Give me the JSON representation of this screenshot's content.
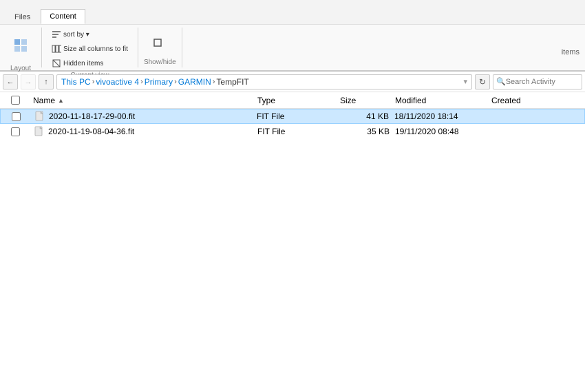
{
  "ribbon": {
    "tabs": [
      {
        "id": "files",
        "label": "Files"
      },
      {
        "id": "content",
        "label": "Content"
      }
    ],
    "sections": [
      {
        "id": "layout",
        "label": "Layout",
        "buttons": []
      },
      {
        "id": "current-view",
        "label": "Current view",
        "buttons": []
      },
      {
        "id": "show-hide",
        "label": "Show/hide",
        "buttons": []
      }
    ]
  },
  "address": {
    "parts": [
      {
        "label": "This PC",
        "id": "this-pc"
      },
      {
        "label": "vivoactive 4",
        "id": "vivoactive4"
      },
      {
        "label": "Primary",
        "id": "primary"
      },
      {
        "label": "GARMIN",
        "id": "garmin"
      },
      {
        "label": "TempFIT",
        "id": "tempfit"
      }
    ],
    "search_placeholder": "Search Activity"
  },
  "items_label": "items",
  "columns": {
    "name": "Name",
    "type": "Type",
    "size": "Size",
    "modified": "Modified",
    "created": "Created"
  },
  "files": [
    {
      "id": "file1",
      "name": "2020-11-18-17-29-00.fit",
      "type": "FIT File",
      "size": "41 KB",
      "modified": "18/11/2020 18:14",
      "created": "",
      "selected": true
    },
    {
      "id": "file2",
      "name": "2020-11-19-08-04-36.fit",
      "type": "FIT File",
      "size": "35 KB",
      "modified": "19/11/2020 08:48",
      "created": "",
      "selected": false
    }
  ]
}
